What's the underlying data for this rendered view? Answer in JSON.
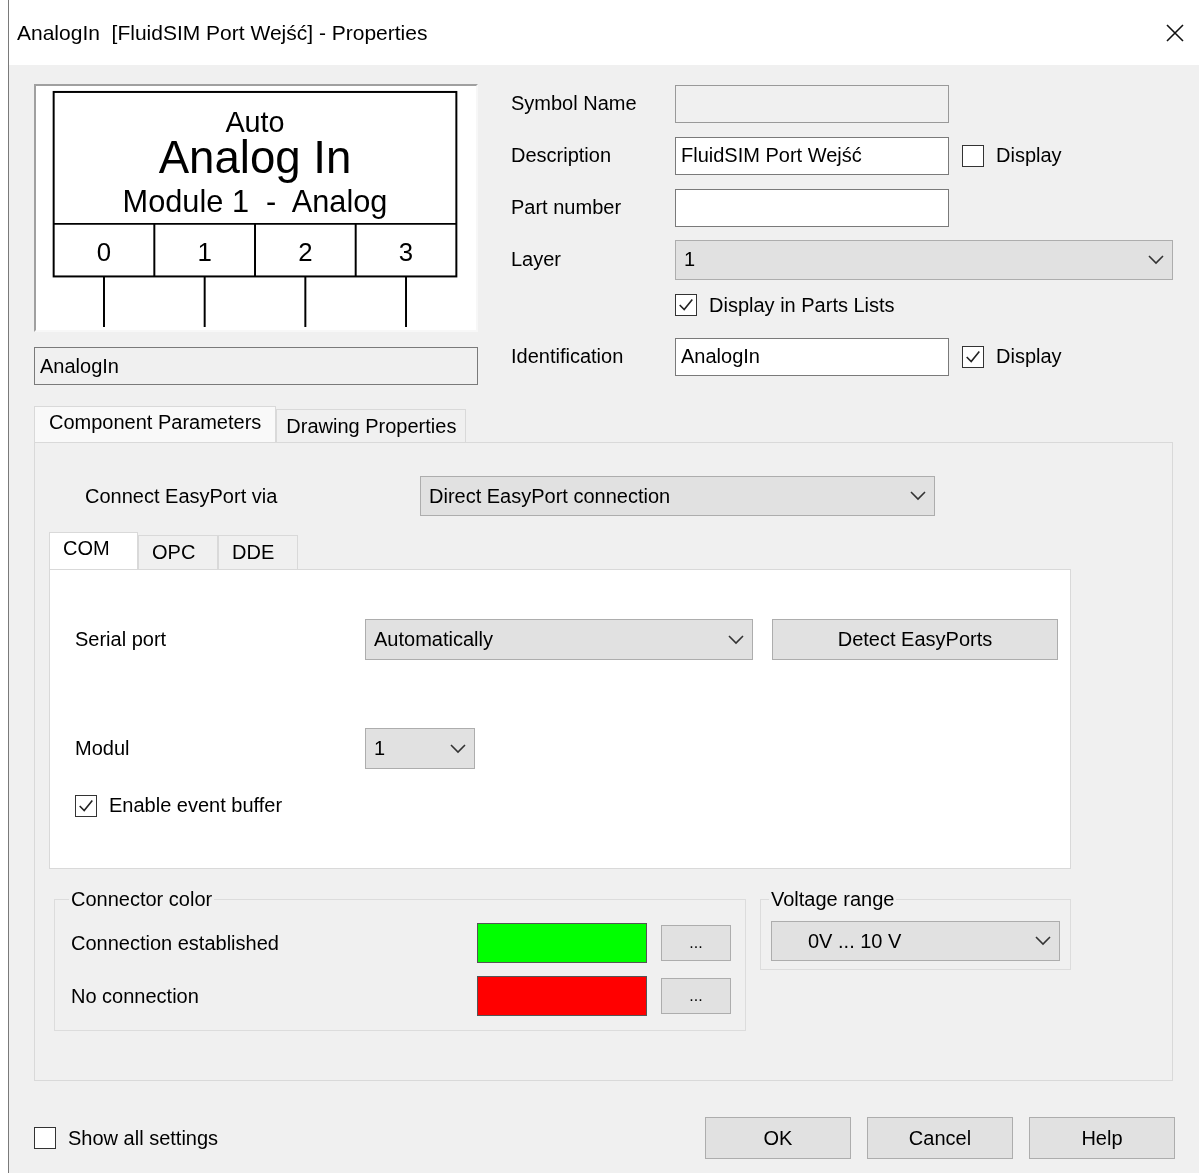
{
  "window": {
    "title": "AnalogIn  [FluidSIM Port Wejść] - Properties"
  },
  "preview": {
    "top": "Auto",
    "title": "Analog In",
    "subtitle": "Module 1  -  Analog",
    "pins": [
      "0",
      "1",
      "2",
      "3"
    ]
  },
  "name_field": {
    "value": "AnalogIn"
  },
  "fields": [
    {
      "kind": "text",
      "label": "Symbol Name",
      "disabled": true
    },
    {
      "kind": "text",
      "label": "Description",
      "value": "FluidSIM Port Wejść",
      "display": {
        "label": "Display",
        "checked": false
      }
    },
    {
      "kind": "text",
      "label": "Part number"
    },
    {
      "kind": "dropdown",
      "label": "Layer",
      "value": "1"
    },
    {
      "kind": "checkbox",
      "label": "Display in Parts Lists",
      "checked": true
    },
    {
      "kind": "text",
      "label": "Identification",
      "value": "AnalogIn",
      "display": {
        "label": "Display",
        "checked": true
      }
    }
  ],
  "tabs": [
    {
      "label": "Component Parameters",
      "selected": true
    },
    {
      "label": "Drawing Properties",
      "selected": false
    }
  ],
  "connect": {
    "label": "Connect EasyPort via",
    "value": "Direct EasyPort connection"
  },
  "inner_tabs": [
    {
      "label": "COM",
      "selected": true
    },
    {
      "label": "OPC",
      "selected": false
    },
    {
      "label": "DDE",
      "selected": false
    }
  ],
  "serial_port": {
    "label": "Serial port",
    "value": "Automatically",
    "button": "Detect EasyPorts"
  },
  "modul": {
    "label": "Modul",
    "value": "1"
  },
  "event_buffer": {
    "label": "Enable event buffer",
    "checked": true
  },
  "connector_color": {
    "title": "Connector color",
    "rows": [
      {
        "label": "Connection established",
        "color": "#00ff00",
        "button": "..."
      },
      {
        "label": "No connection",
        "color": "#ff0000",
        "button": "..."
      }
    ]
  },
  "voltage_range": {
    "title": "Voltage range",
    "value": "0V ... 10 V"
  },
  "show_all": {
    "label": "Show all settings",
    "checked": false
  },
  "buttons": [
    "OK",
    "Cancel",
    "Help"
  ]
}
